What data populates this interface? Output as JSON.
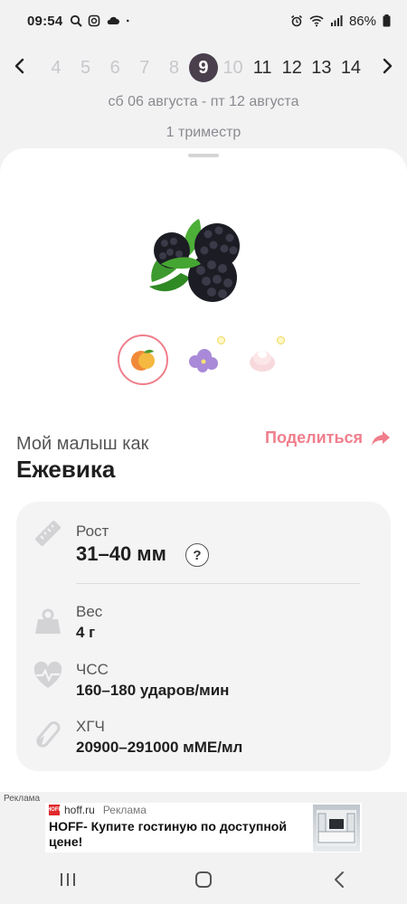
{
  "status_bar": {
    "time": "09:54",
    "battery": "86%",
    "left_icons": [
      "search-icon",
      "instagram-icon",
      "cloud-icon",
      "dot-icon"
    ],
    "right_icons": [
      "alarm-icon",
      "wifi-icon",
      "signal-icon",
      "battery-icon"
    ]
  },
  "week_nav": {
    "weeks": [
      "4",
      "5",
      "6",
      "7",
      "8",
      "9",
      "10",
      "11",
      "12",
      "13",
      "14"
    ],
    "current": "9"
  },
  "date_range": "сб 06 августа - пт 12 августа",
  "trimester": "1 триместр",
  "comparison": {
    "intro": "Мой малыш как",
    "fruit": "Ежевика",
    "share_label": "Поделиться"
  },
  "stats": {
    "height": {
      "label": "Рост",
      "value": "31–40 мм",
      "help": "?"
    },
    "weight": {
      "label": "Вес",
      "value": "4 г"
    },
    "heart_rate": {
      "label": "ЧСС",
      "value": "160–180 ударов/мин"
    },
    "hcg": {
      "label": "ХГЧ",
      "value": "20900–291000 мМЕ/мл"
    }
  },
  "ad": {
    "tag": "Реклама",
    "source": "hoff.ru",
    "source_label": "Реклама",
    "logo_text": "HOFF",
    "title": "HOFF- Купите гостиную по доступной цене!"
  },
  "colors": {
    "accent": "#f07e8c",
    "active_week": "#4a3f4d",
    "card_bg": "#f4f4f5"
  }
}
